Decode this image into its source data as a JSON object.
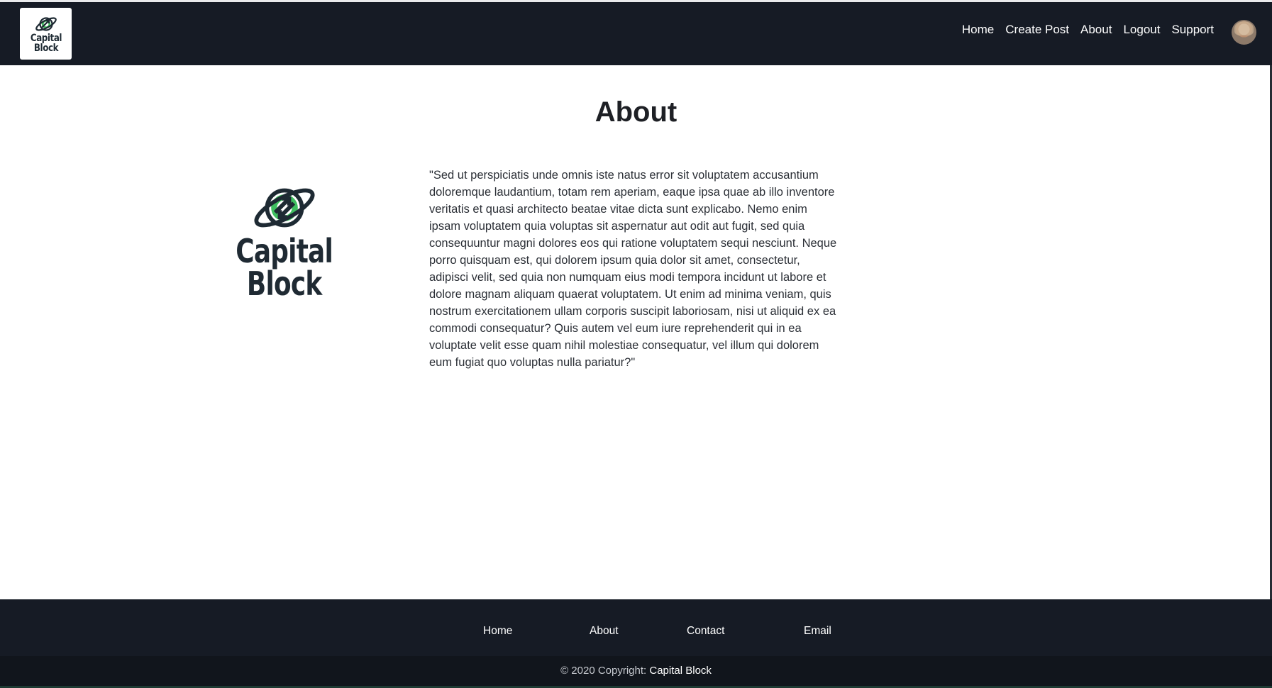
{
  "brand": {
    "logo_line1": "Capital",
    "logo_line2": "Block",
    "accent": "#3fbf5f",
    "dark": "#1e2a33"
  },
  "nav": {
    "items": [
      {
        "label": "Home"
      },
      {
        "label": "Create Post"
      },
      {
        "label": "About"
      },
      {
        "label": "Logout"
      },
      {
        "label": "Support"
      }
    ]
  },
  "main": {
    "title": "About",
    "body": "\"Sed ut perspiciatis unde omnis iste natus error sit voluptatem accusantium doloremque laudantium, totam rem aperiam, eaque ipsa quae ab illo inventore veritatis et quasi architecto beatae vitae dicta sunt explicabo. Nemo enim ipsam voluptatem quia voluptas sit aspernatur aut odit aut fugit, sed quia consequuntur magni dolores eos qui ratione voluptatem sequi nesciunt. Neque porro quisquam est, qui dolorem ipsum quia dolor sit amet, consectetur, adipisci velit, sed quia non numquam eius modi tempora incidunt ut labore et dolore magnam aliquam quaerat voluptatem. Ut enim ad minima veniam, quis nostrum exercitationem ullam corporis suscipit laboriosam, nisi ut aliquid ex ea commodi consequatur? Quis autem vel eum iure reprehenderit qui in ea voluptate velit esse quam nihil molestiae consequatur, vel illum qui dolorem eum fugiat quo voluptas nulla pariatur?\""
  },
  "footer": {
    "links": [
      {
        "label": "Home"
      },
      {
        "label": "About"
      },
      {
        "label": "Contact"
      },
      {
        "label": "Email"
      }
    ],
    "copyright_prefix": "© 2020 Copyright: ",
    "copyright_brand": "Capital Block"
  },
  "colors": {
    "nav_bg": "#161b25",
    "footer_bg": "#161b25",
    "copyright_bg": "#11151c",
    "text_dark": "#1e2025"
  }
}
